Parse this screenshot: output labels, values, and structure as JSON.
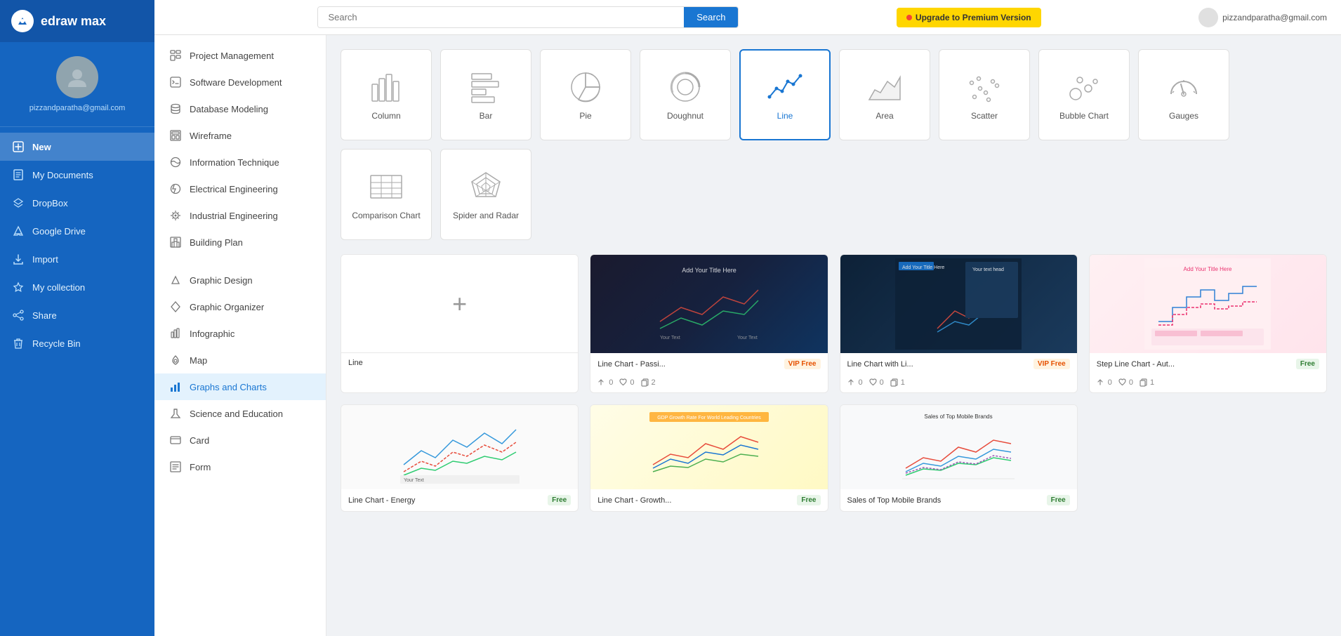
{
  "app": {
    "logo_text": "edraw max",
    "logo_letter": "d"
  },
  "user": {
    "email": "pizzandparatha@gmail.com"
  },
  "header": {
    "search_placeholder": "Search",
    "search_btn": "Search",
    "upgrade_btn": "Upgrade to Premium Version"
  },
  "sidebar": {
    "items": [
      {
        "id": "new",
        "label": "New",
        "active": true
      },
      {
        "id": "my-documents",
        "label": "My Documents",
        "active": false
      },
      {
        "id": "dropbox",
        "label": "DropBox",
        "active": false
      },
      {
        "id": "google-drive",
        "label": "Google Drive",
        "active": false
      },
      {
        "id": "import",
        "label": "Import",
        "active": false
      },
      {
        "id": "my-collection",
        "label": "My collection",
        "active": false
      },
      {
        "id": "share",
        "label": "Share",
        "active": false
      },
      {
        "id": "recycle-bin",
        "label": "Recycle Bin",
        "active": false
      }
    ]
  },
  "submenu": {
    "items_top": [
      {
        "id": "project-management",
        "label": "Project Management"
      },
      {
        "id": "software-development",
        "label": "Software Development"
      },
      {
        "id": "database-modeling",
        "label": "Database Modeling"
      },
      {
        "id": "wireframe",
        "label": "Wireframe"
      },
      {
        "id": "information-technique",
        "label": "Information Technique"
      },
      {
        "id": "electrical-engineering",
        "label": "Electrical Engineering"
      },
      {
        "id": "industrial-engineering",
        "label": "Industrial Engineering"
      },
      {
        "id": "building-plan",
        "label": "Building Plan"
      }
    ],
    "items_bottom": [
      {
        "id": "graphic-design",
        "label": "Graphic Design"
      },
      {
        "id": "graphic-organizer",
        "label": "Graphic Organizer"
      },
      {
        "id": "infographic",
        "label": "Infographic"
      },
      {
        "id": "map",
        "label": "Map"
      },
      {
        "id": "graphs-and-charts",
        "label": "Graphs and Charts",
        "active": true
      },
      {
        "id": "science-and-education",
        "label": "Science and Education"
      },
      {
        "id": "card",
        "label": "Card"
      },
      {
        "id": "form",
        "label": "Form"
      }
    ]
  },
  "chart_types": [
    {
      "id": "column",
      "label": "Column",
      "selected": false
    },
    {
      "id": "bar",
      "label": "Bar",
      "selected": false
    },
    {
      "id": "pie",
      "label": "Pie",
      "selected": false
    },
    {
      "id": "doughnut",
      "label": "Doughnut",
      "selected": false
    },
    {
      "id": "line",
      "label": "Line",
      "selected": true
    },
    {
      "id": "area",
      "label": "Area",
      "selected": false
    },
    {
      "id": "scatter",
      "label": "Scatter",
      "selected": false
    },
    {
      "id": "bubble",
      "label": "Bubble Chart",
      "selected": false
    },
    {
      "id": "gauges",
      "label": "Gauges",
      "selected": false
    },
    {
      "id": "comparison",
      "label": "Comparison Chart",
      "selected": false
    },
    {
      "id": "spider",
      "label": "Spider and Radar",
      "selected": false
    }
  ],
  "templates": [
    {
      "id": "create-new",
      "name": "Line",
      "badge": "",
      "type": "new",
      "stats": null
    },
    {
      "id": "line-passi",
      "name": "Line Chart - Passi...",
      "badge": "VIP Free",
      "badge_type": "vip",
      "stats": {
        "likes": 0,
        "hearts": 0,
        "copies": 2
      },
      "thumb": "dark"
    },
    {
      "id": "line-with-li",
      "name": "Line Chart with Li...",
      "badge": "VIP Free",
      "badge_type": "vip",
      "stats": {
        "likes": 0,
        "hearts": 0,
        "copies": 1
      },
      "thumb": "navy"
    },
    {
      "id": "step-line",
      "name": "Step Line Chart - Aut...",
      "badge": "Free",
      "badge_type": "free",
      "stats": {
        "likes": 0,
        "hearts": 0,
        "copies": 1
      },
      "thumb": "pink"
    },
    {
      "id": "line-energy",
      "name": "Line Chart - Energy",
      "badge": "Free",
      "badge_type": "free",
      "stats": null,
      "thumb": "white"
    },
    {
      "id": "line-growth",
      "name": "Line Chart - Growth...",
      "badge": "Free",
      "badge_type": "free",
      "stats": null,
      "thumb": "yellow"
    },
    {
      "id": "sales-mobile",
      "name": "Sales of Top Mobile Brands",
      "badge": "Free",
      "badge_type": "free",
      "stats": null,
      "thumb": "light"
    }
  ]
}
